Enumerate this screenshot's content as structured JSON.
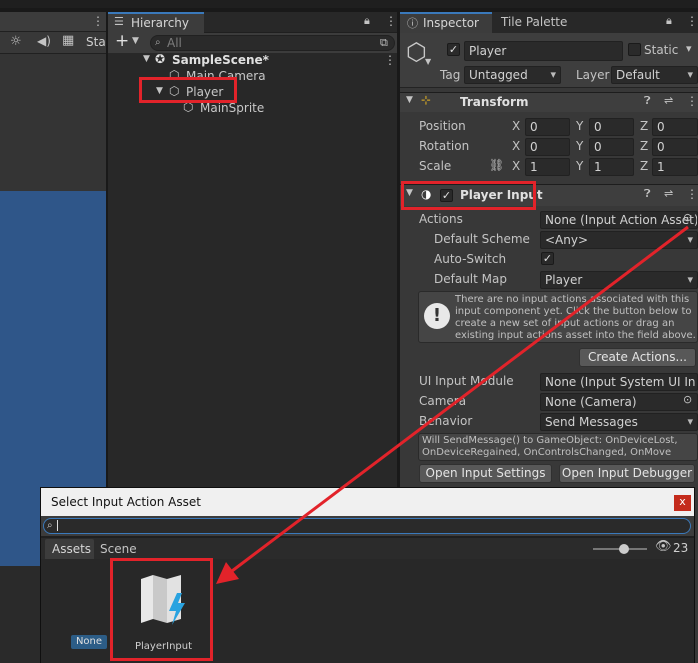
{
  "left_toolbar": {
    "stats_label": "Sta"
  },
  "hierarchy": {
    "tab": "Hierarchy",
    "add_label": "+",
    "search_placeholder": "All",
    "scene": "SampleScene*",
    "items": [
      {
        "label": "Main Camera"
      },
      {
        "label": "Player"
      },
      {
        "label": "MainSprite"
      }
    ]
  },
  "inspector": {
    "tabs": [
      "Inspector",
      "Tile Palette"
    ],
    "object_name": "Player",
    "static_label": "Static",
    "tag_label": "Tag",
    "tag_value": "Untagged",
    "layer_label": "Layer",
    "layer_value": "Default",
    "transform": {
      "title": "Transform",
      "rows": [
        {
          "label": "Position",
          "x": "0",
          "y": "0",
          "z": "0"
        },
        {
          "label": "Rotation",
          "x": "0",
          "y": "0",
          "z": "0"
        },
        {
          "label": "Scale",
          "x": "1",
          "y": "1",
          "z": "1"
        }
      ],
      "axis": [
        "X",
        "Y",
        "Z"
      ]
    },
    "player_input": {
      "title": "Player Input",
      "actions_label": "Actions",
      "actions_value": "None (Input Action Asset)",
      "default_scheme_label": "Default Scheme",
      "default_scheme_value": "<Any>",
      "auto_switch_label": "Auto-Switch",
      "default_map_label": "Default Map",
      "default_map_value": "Player",
      "info_text": "There are no input actions associated with this input component yet. Click the button below to create a new set of input actions or drag an existing input actions asset into the field above.",
      "create_actions": "Create Actions...",
      "ui_input_module_label": "UI Input Module",
      "ui_input_module_value": "None (Input System UI In",
      "camera_label": "Camera",
      "camera_value": "None (Camera)",
      "behavior_label": "Behavior",
      "behavior_value": "Send Messages",
      "messages_text": "Will SendMessage() to GameObject: OnDeviceLost, OnDeviceRegained, OnControlsChanged, OnMove",
      "open_settings": "Open Input Settings",
      "open_debugger": "Open Input Debugger"
    }
  },
  "picker": {
    "title": "Select Input Action Asset",
    "close": "x",
    "tabs": [
      "Assets",
      "Scene"
    ],
    "hidden_count": "23",
    "slider_level": 0.7,
    "none_label": "None",
    "asset_name": "PlayerInput"
  },
  "colors": {
    "highlight": "#e2232a",
    "scene_view": "#2f5689",
    "asset_icon": "#29a3e0"
  }
}
